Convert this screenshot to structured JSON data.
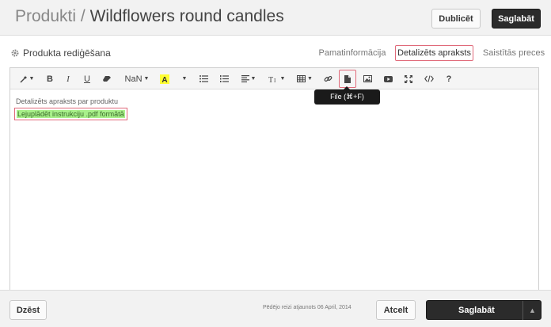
{
  "header": {
    "breadcrumb": "Produkti",
    "separator": "/",
    "product_name": "Wildflowers round candles",
    "duplicate_label": "Dublicēt",
    "save_label": "Saglabāt"
  },
  "panel": {
    "title": "Produkta rediģēšana",
    "tabs": [
      {
        "label": "Pamatinformācija",
        "active": false
      },
      {
        "label": "Detalizēts apraksts",
        "active": true
      },
      {
        "label": "Saistītās preces",
        "active": false
      }
    ]
  },
  "toolbar": {
    "font_size_label": "NaN",
    "bold": "B",
    "italic": "I",
    "underline": "U",
    "help": "?",
    "file_tooltip": "File (⌘+F)",
    "icons": [
      "magic-wand-icon",
      "bold-icon",
      "italic-icon",
      "underline-icon",
      "eraser-icon",
      "font-size-dropdown",
      "highlight-color-icon",
      "color-dropdown-icon",
      "unordered-list-icon",
      "ordered-list-icon",
      "align-icon",
      "text-height-icon",
      "table-icon",
      "link-icon",
      "file-icon",
      "image-icon",
      "video-icon",
      "fullscreen-icon",
      "code-view-icon",
      "help-icon"
    ]
  },
  "editor": {
    "label": "Detalizēts apraksts par produktu",
    "link_text": "Lejuplādēt instrukciju .pdf formātā"
  },
  "footer": {
    "delete_label": "Dzēst",
    "last_updated": "Pēdējo reizi atjaunots 06 April, 2014",
    "cancel_label": "Atcelt",
    "save_label": "Saglabāt"
  },
  "colors": {
    "accent_border": "#e06a7a",
    "highlight": "#a8f08a",
    "dark_button": "#2b2b2b"
  }
}
